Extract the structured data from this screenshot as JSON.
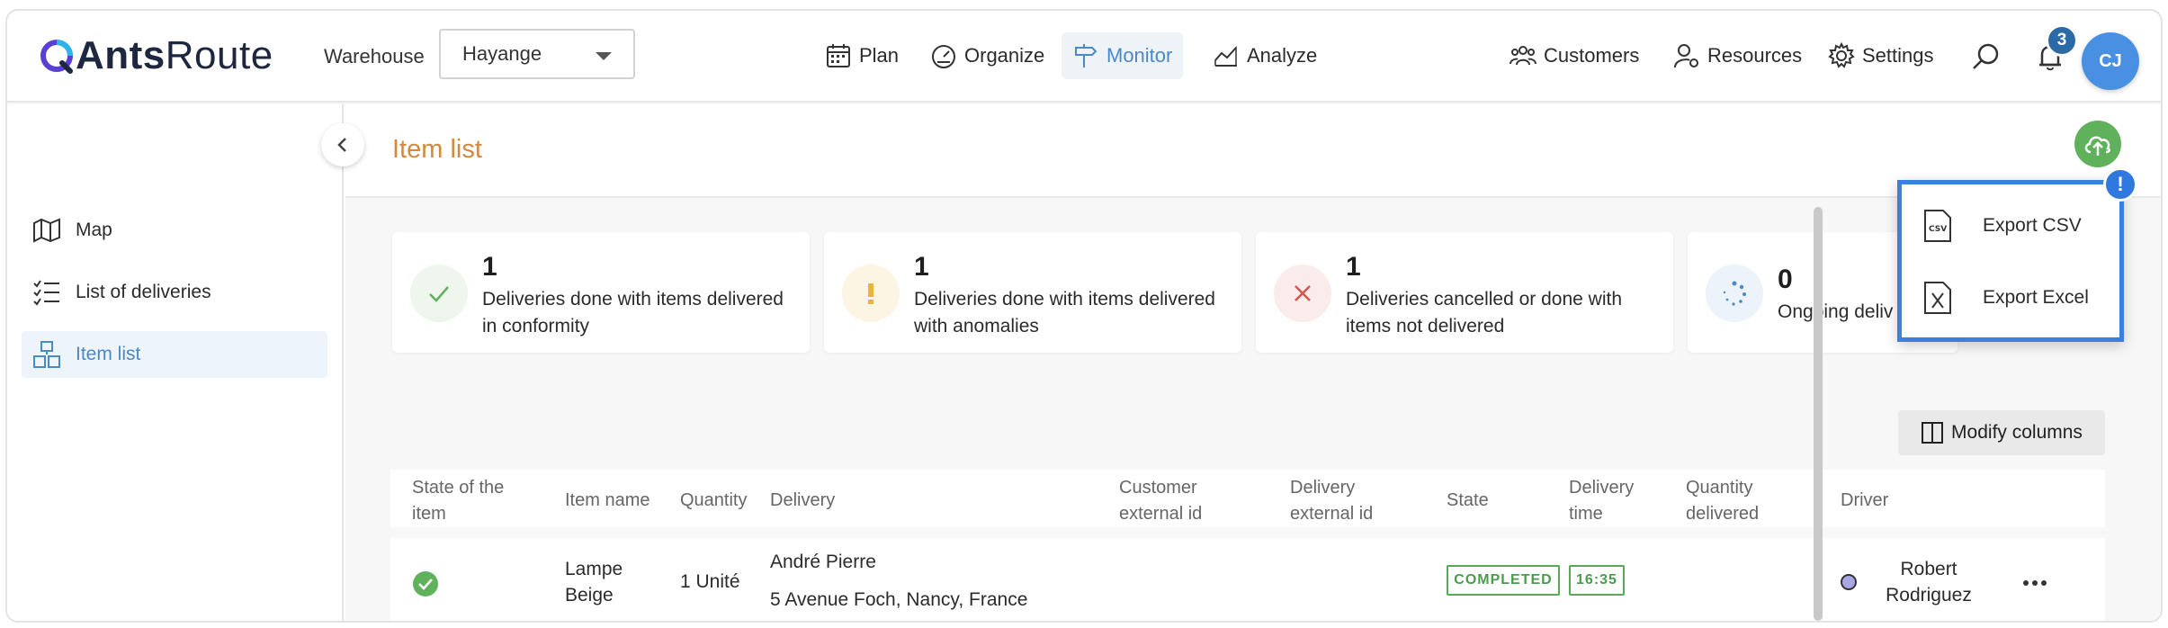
{
  "header": {
    "logo": {
      "bold": "Ants",
      "light": "Route"
    },
    "warehouse_label": "Warehouse",
    "warehouse_value": "Hayange",
    "nav": [
      {
        "label": "Plan",
        "icon": "calendar-icon"
      },
      {
        "label": "Organize",
        "icon": "gauge-icon"
      },
      {
        "label": "Monitor",
        "icon": "signpost-icon",
        "active": true
      },
      {
        "label": "Analyze",
        "icon": "chart-icon"
      }
    ],
    "right_nav": [
      {
        "label": "Customers",
        "icon": "users-icon"
      },
      {
        "label": "Resources",
        "icon": "user-gear-icon"
      },
      {
        "label": "Settings",
        "icon": "gear-icon"
      }
    ],
    "notification_count": "3",
    "avatar_initials": "CJ"
  },
  "sidebar": {
    "items": [
      {
        "label": "Map",
        "icon": "map-icon"
      },
      {
        "label": "List of deliveries",
        "icon": "checklist-icon"
      },
      {
        "label": "Item list",
        "icon": "boxes-icon",
        "active": true
      }
    ]
  },
  "page": {
    "title": "Item list"
  },
  "cards": [
    {
      "count": "1",
      "text": "Deliveries done with items delivered in conformity",
      "icon": "check-icon",
      "color": "#5fb25b"
    },
    {
      "count": "1",
      "text": "Deliveries done with items delivered with anomalies",
      "icon": "exclamation-icon",
      "color": "#e8b43a"
    },
    {
      "count": "1",
      "text": "Deliveries cancelled or done with items not delivered",
      "icon": "x-icon",
      "color": "#d9534f"
    },
    {
      "count": "0",
      "text": "Ongoing deliv",
      "icon": "spinner-icon",
      "color": "#4a89c6"
    }
  ],
  "toolbar": {
    "modify_columns_label": "Modify columns"
  },
  "table": {
    "headers": [
      "State of the item",
      "Item name",
      "Quantity",
      "Delivery",
      "Customer external id",
      "Delivery external id",
      "State",
      "Delivery time",
      "Quantity delivered",
      "Driver"
    ],
    "rows": [
      {
        "state_icon": "check-circle-icon",
        "item_name": "Lampe Beige",
        "quantity": "1 Unité",
        "delivery_name": "André Pierre",
        "delivery_address": "5 Avenue Foch, Nancy, France",
        "customer_external_id": "",
        "delivery_external_id": "",
        "state": "COMPLETED",
        "delivery_time": "16:35",
        "quantity_delivered": "",
        "driver": "Robert Rodriguez",
        "driver_color": "#a9a6e6"
      }
    ]
  },
  "export_menu": {
    "alert": "!",
    "items": [
      {
        "label": "Export CSV",
        "icon": "csv-file-icon"
      },
      {
        "label": "Export Excel",
        "icon": "excel-file-icon"
      }
    ]
  },
  "colors": {
    "accent": "#4a89c6",
    "title": "#d4893e",
    "success": "#5fb25b",
    "highlight": "#3b7fe0"
  }
}
